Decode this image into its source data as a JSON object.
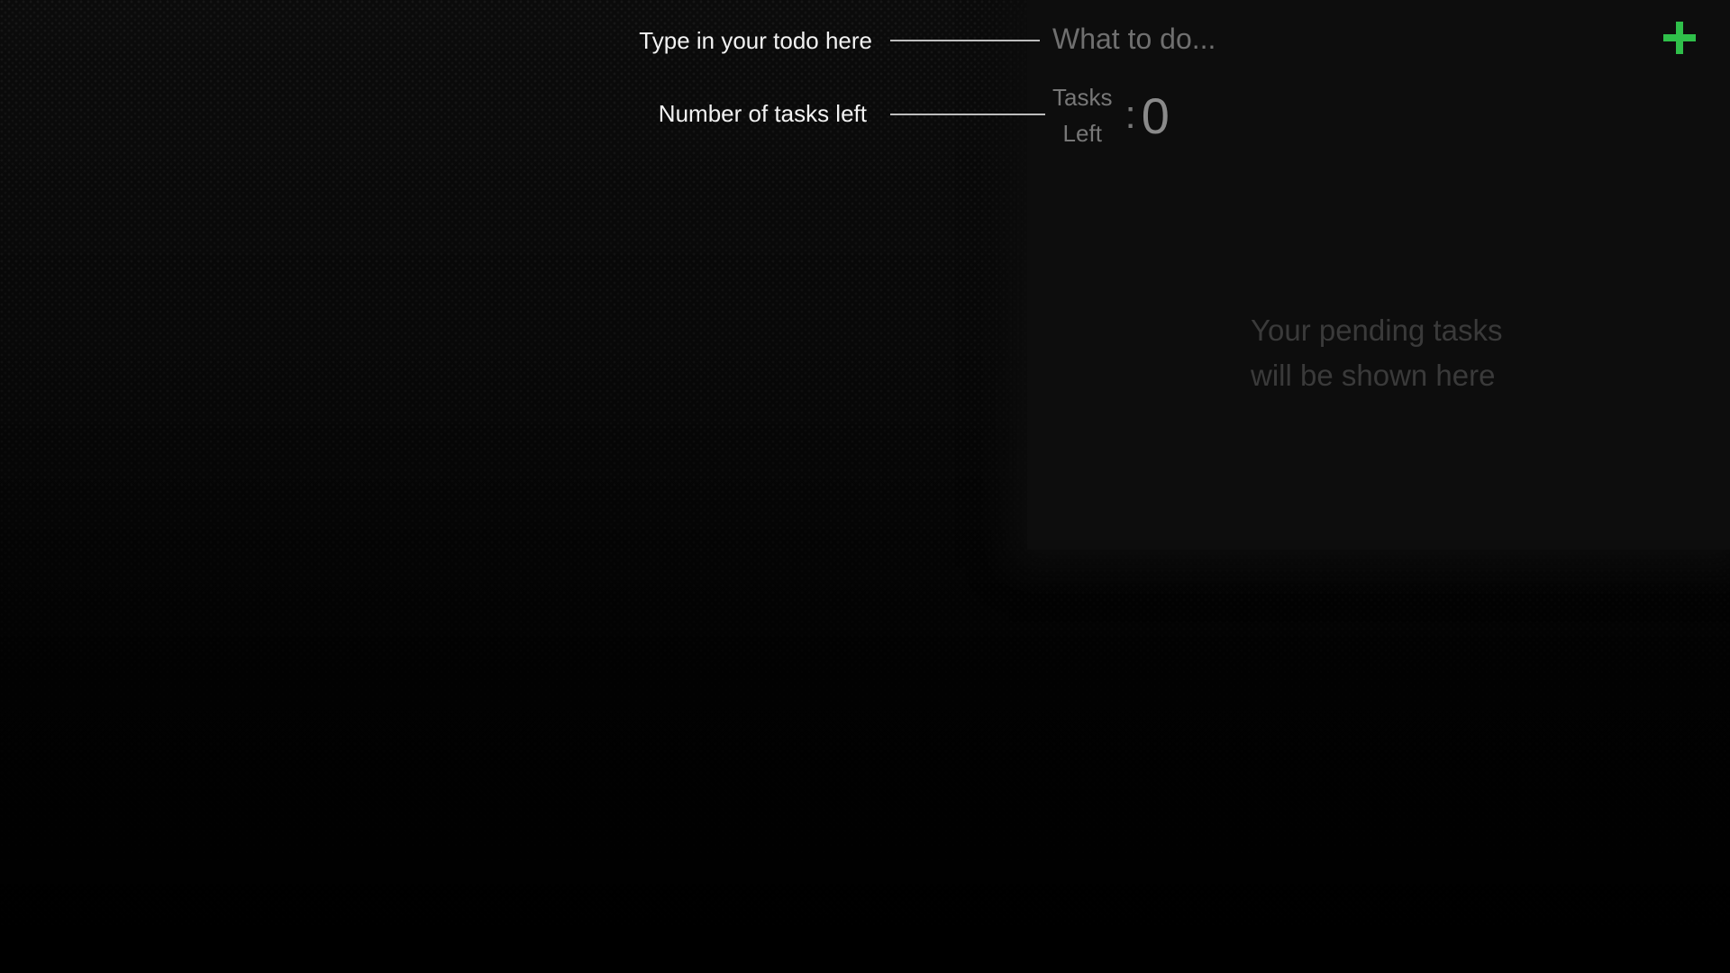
{
  "annotations": {
    "input_hint": "Type in your todo here",
    "count_hint": "Number of tasks left"
  },
  "todo_input": {
    "placeholder": "What to do...",
    "value": ""
  },
  "add_button": {
    "icon": "plus-icon",
    "color": "#2fbf4a"
  },
  "tasks_left": {
    "label_line1": "Tasks",
    "label_line2": "Left",
    "separator": ":",
    "count": "0"
  },
  "task_list": {
    "empty_line1": "Your pending tasks",
    "empty_line2": "will be shown here"
  }
}
